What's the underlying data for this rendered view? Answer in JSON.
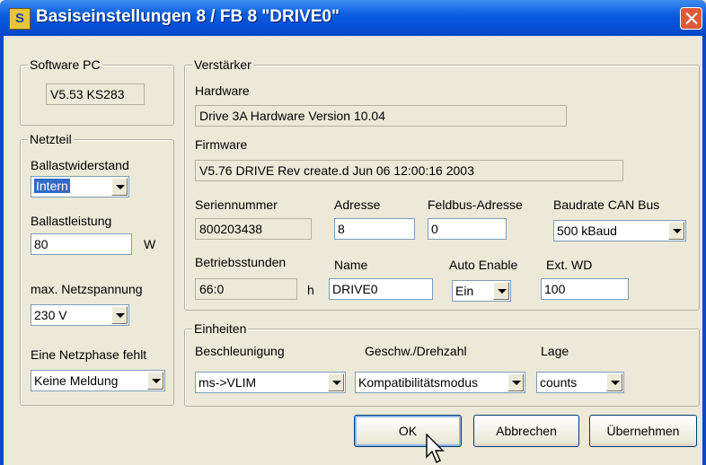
{
  "window": {
    "title": "Basiseinstellungen 8 / FB 8 \"DRIVE0\"",
    "icon_letter": "S"
  },
  "software_pc": {
    "legend": "Software PC",
    "version": "V5.53 KS283"
  },
  "netzteil": {
    "legend": "Netzteil",
    "ballastwiderstand_label": "Ballastwiderstand",
    "ballastwiderstand_value": "Intern",
    "ballastleistung_label": "Ballastleistung",
    "ballastleistung_value": "80",
    "ballastleistung_unit": "W",
    "netzspannung_label": "max. Netzspannung",
    "netzspannung_value": "230 V",
    "netzphase_label": "Eine Netzphase fehlt",
    "netzphase_value": "Keine Meldung"
  },
  "verstaerker": {
    "legend": "Verstärker",
    "hardware_label": "Hardware",
    "hardware_value": "Drive 3A Hardware Version 10.04",
    "firmware_label": "Firmware",
    "firmware_value": "V5.76 DRIVE Rev create.d Jun 06 12:00:16 2003",
    "seriennummer_label": "Seriennummer",
    "seriennummer_value": "800203438",
    "adresse_label": "Adresse",
    "adresse_value": "8",
    "feldbus_label": "Feldbus-Adresse",
    "feldbus_value": "0",
    "baudrate_label": "Baudrate CAN Bus",
    "baudrate_value": "500 kBaud",
    "betriebsstunden_label": "Betriebsstunden",
    "betriebsstunden_value": "66:0",
    "betriebsstunden_unit": "h",
    "name_label": "Name",
    "name_value": "DRIVE0",
    "auto_enable_label": "Auto Enable",
    "auto_enable_value": "Ein",
    "ext_wd_label": "Ext. WD",
    "ext_wd_value": "100"
  },
  "einheiten": {
    "legend": "Einheiten",
    "beschleunigung_label": "Beschleunigung",
    "beschleunigung_value": "ms->VLIM",
    "geschw_label": "Geschw./Drehzahl",
    "geschw_value": "Kompatibilitätsmodus",
    "lage_label": "Lage",
    "lage_value": "counts"
  },
  "buttons": {
    "ok": "OK",
    "abbrechen": "Abbrechen",
    "uebernehmen": "Übernehmen"
  },
  "icons": [
    "app-icon",
    "close-icon",
    "dropdown-arrow-icon",
    "mouse-cursor-icon"
  ]
}
